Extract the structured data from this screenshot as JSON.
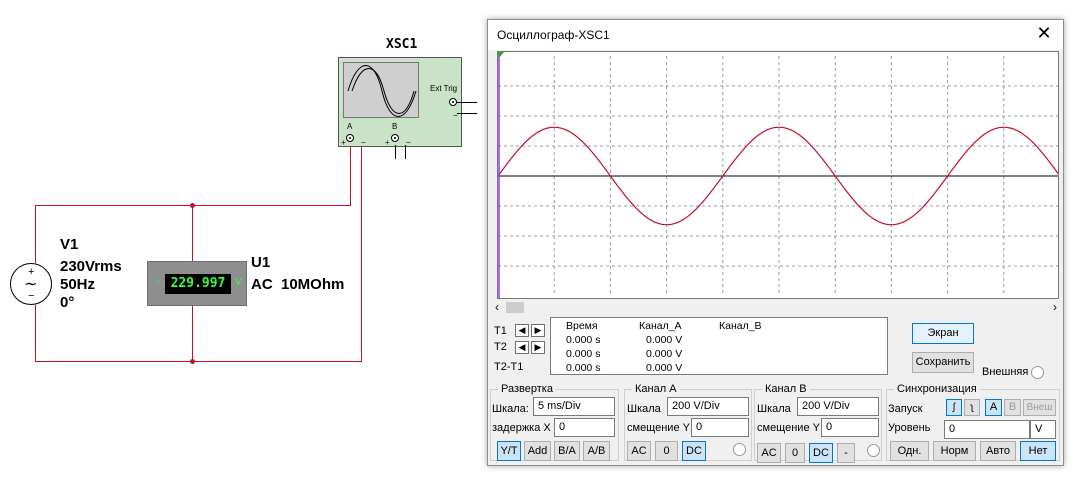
{
  "schematic": {
    "oscilloscope_label": "XSC1",
    "ext_trig_label": "Ext Trig",
    "channel_a_label": "A",
    "channel_b_label": "B",
    "source": {
      "name": "V1",
      "voltage": "230Vrms",
      "frequency": "50Hz",
      "phase": "0°"
    },
    "meter": {
      "name": "U1",
      "reading": "229.997",
      "unit": "V",
      "mode_resistance": "AC  10MOhm"
    },
    "colors": {
      "wire": "#c0102a"
    }
  },
  "window": {
    "title": "Осциллограф-XSC1",
    "close_icon": "close-icon",
    "screen": {
      "trace_color": "#c0102a",
      "cursor_color": "#9b30ff",
      "time_per_div_ms": 5,
      "volts_per_div": 200,
      "amplitude_v": 325,
      "frequency_hz": 50,
      "cursor_t1_fraction": 0
    },
    "readout": {
      "t1_label": "T1",
      "t2_label": "T2",
      "t2t1_label": "T2-T1",
      "headers": [
        "Время",
        "Канал_А",
        "Канал_В"
      ],
      "rows": [
        [
          "0.000 s",
          "0.000 V",
          ""
        ],
        [
          "0.000 s",
          "0.000 V",
          ""
        ],
        [
          "0.000 s",
          "0.000 V",
          ""
        ]
      ]
    },
    "buttons": {
      "screen": "Экран",
      "save": "Сохранить",
      "external_label": "Внешняя"
    },
    "sweep": {
      "title": "Развертка",
      "scale_label": "Шкала:",
      "scale_value": "5 ms/Div",
      "delay_label": "задержка X",
      "delay_value": "0",
      "modes": [
        "Y/T",
        "Add",
        "B/A",
        "A/B"
      ]
    },
    "channel_a": {
      "title": "Канал А",
      "scale_label": "Шкала",
      "scale_value": "200  V/Div",
      "offset_label": "смещение Y",
      "offset_value": "0",
      "coupling": [
        "AC",
        "0",
        "DC"
      ]
    },
    "channel_b": {
      "title": "Канал В",
      "scale_label": "Шкала",
      "scale_value": "200  V/Div",
      "offset_label": "смещение Y",
      "offset_value": "0",
      "coupling": [
        "AC",
        "0",
        "DC",
        "-"
      ]
    },
    "trigger": {
      "title": "Синхронизация",
      "start_label": "Запуск",
      "edge_rise": "rising-edge-icon",
      "edge_fall": "falling-edge-icon",
      "sources": [
        "A",
        "B",
        "Внеш"
      ],
      "level_label": "Уровень",
      "level_value": "0",
      "level_unit": "V",
      "modes": [
        "Одн.",
        "Норм",
        "Авто",
        "Нет"
      ]
    }
  }
}
